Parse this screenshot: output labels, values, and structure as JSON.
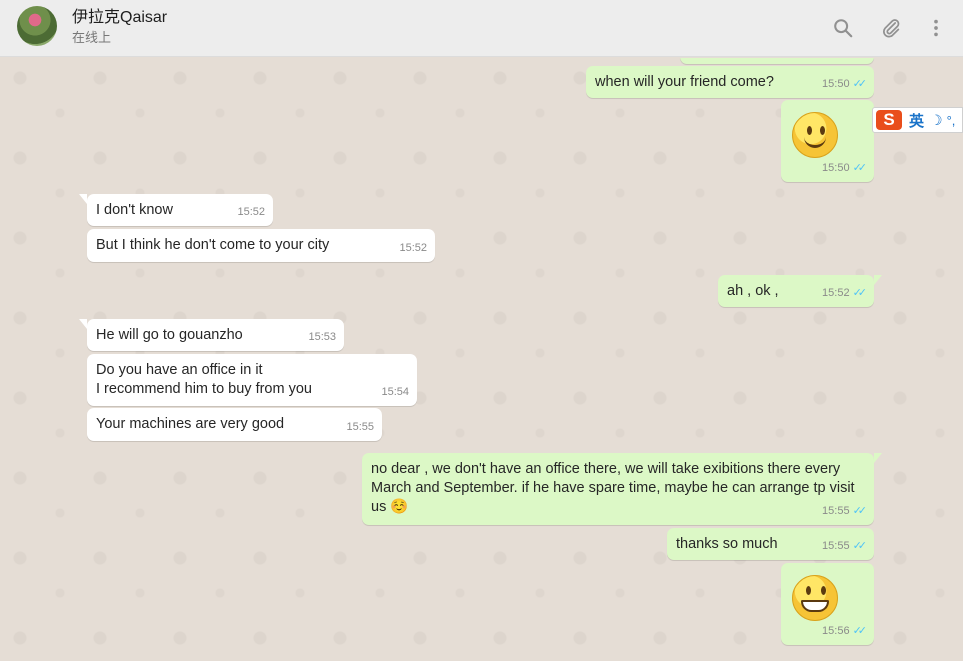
{
  "header": {
    "contact_name": "伊拉克Qaisar",
    "status": "在线上"
  },
  "messages": [
    {
      "id": "m0",
      "dir": "out",
      "text": "when will your friend come?",
      "time": "15:50"
    },
    {
      "id": "m1",
      "dir": "out",
      "emoji": "slight-smile",
      "time": "15:50"
    },
    {
      "id": "m2",
      "dir": "in",
      "text": "I don't know",
      "time": "15:52"
    },
    {
      "id": "m3",
      "dir": "in",
      "text": "But I think he don't come to your city",
      "time": "15:52"
    },
    {
      "id": "m4",
      "dir": "out",
      "text": "ah , ok ,",
      "time": "15:52"
    },
    {
      "id": "m5",
      "dir": "in",
      "text": "He will go to gouanzho",
      "time": "15:53"
    },
    {
      "id": "m6",
      "dir": "in",
      "line1": "Do you have an office in it",
      "line2": "I recommend him to buy from you",
      "time": "15:54"
    },
    {
      "id": "m7",
      "dir": "in",
      "text": "Your machines are very good",
      "time": "15:55"
    },
    {
      "id": "m8",
      "dir": "out",
      "line1": "no dear , we don't have an office there, we will take exibitions there every",
      "line2": "March and September.  if he have spare time, maybe he can arrange tp visit",
      "line3": "us ☺️",
      "time": "15:55"
    },
    {
      "id": "m9",
      "dir": "out",
      "text": "thanks so much",
      "time": "15:55"
    },
    {
      "id": "m10",
      "dir": "out",
      "emoji": "grin",
      "time": "15:56"
    }
  ],
  "ime": {
    "label": "英"
  },
  "colors": {
    "incoming": "#ffffff",
    "outgoing": "#dcf8c6",
    "read_ticks": "#4fc3f7",
    "background": "#e5ddd5"
  }
}
